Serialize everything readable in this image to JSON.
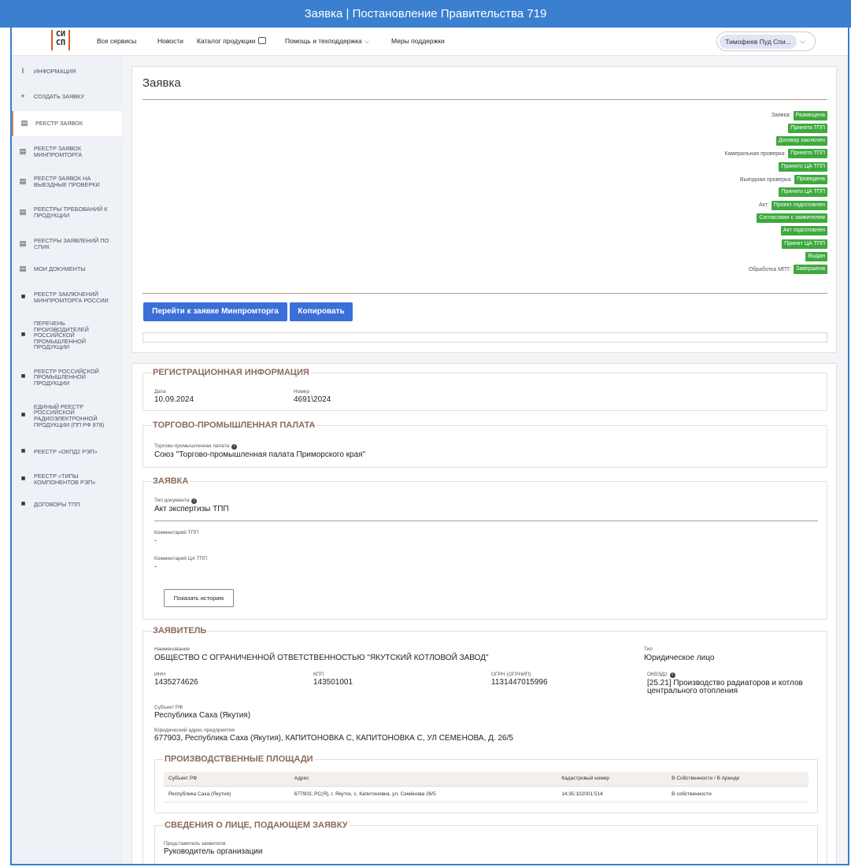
{
  "window_title": "Заявка | Постановление Правительства 719",
  "nav": {
    "logo": "СИ СП",
    "links": [
      "Все сервисы",
      "Новости",
      "Каталог продукции",
      "Помощь и техподдержка",
      "Меры поддержки"
    ],
    "user": "Тимофеев Пуд Спи..."
  },
  "sidebar": {
    "items": [
      {
        "label": "Информация",
        "icon": "info-icon"
      },
      {
        "label": "Создать заявку",
        "icon": "plus-icon"
      },
      {
        "label": "Реестр заявок",
        "icon": "document-icon"
      },
      {
        "label": "Реестр заявок Минпромторга",
        "icon": "document-icon"
      },
      {
        "label": "Реестр заявок на выездные проверки",
        "icon": "document-icon"
      },
      {
        "label": "Реестры требований к продукции",
        "icon": "document-icon"
      },
      {
        "label": "Реестры заявлений по СПИК",
        "icon": "document-icon"
      },
      {
        "label": "Мои документы",
        "icon": "document-icon"
      },
      {
        "label": "Реестр заключений Минпромторга России",
        "icon": "book-icon"
      },
      {
        "label": "Перечень производителей российской промышленной продукции",
        "icon": "book-icon"
      },
      {
        "label": "Реестр российской промышленной продукции",
        "icon": "book-icon"
      },
      {
        "label": "Единый реестр российской радиоэлектронной продукции (ПП РФ 878)",
        "icon": "book-icon"
      },
      {
        "label": "Реестр «ОКПД2 РЭП»",
        "icon": "book-icon"
      },
      {
        "label": "Реестр «Типы компонентов РЭП»",
        "icon": "book-icon"
      },
      {
        "label": "Договоры ТПП",
        "icon": "book-icon"
      }
    ],
    "active_index": 2
  },
  "request": {
    "title": "Заявка",
    "statuses": [
      {
        "label": "Заявка:",
        "value": "Размещена"
      },
      {
        "label": "",
        "value": "Принята ТПП"
      },
      {
        "label": "",
        "value": "Договор заключен"
      },
      {
        "label": "Камеральная проверка:",
        "value": "Принято ТПП"
      },
      {
        "label": "",
        "value": "Принято ЦА ТПП"
      },
      {
        "label": "Выездная проверка:",
        "value": "Проведена"
      },
      {
        "label": "",
        "value": "Принято ЦА ТПП"
      },
      {
        "label": "Акт:",
        "value": "Проект подготовлен"
      },
      {
        "label": "",
        "value": "Согласован с заявителем"
      },
      {
        "label": "",
        "value": "Акт подготовлен"
      },
      {
        "label": "",
        "value": "Принят ЦА ТПП"
      },
      {
        "label": "",
        "value": "Выдан"
      },
      {
        "label": "Обработка МПТ:",
        "value": "Завершена"
      }
    ],
    "badge_color": "#3ea93e",
    "go_button": "Перейти к заявке Минпромторга",
    "copy_button": "Копировать"
  },
  "registration": {
    "legend": "Регистрационная информация",
    "date_label": "Дата",
    "date": "10.09.2024",
    "number_label": "Номер",
    "number": "4691\\2024"
  },
  "chamber": {
    "legend": "Торгово-промышленная палата",
    "label": "Торгово-промышленная палата",
    "value": "Союз \"Торгово-промышленная палата Приморского края\""
  },
  "application": {
    "legend": "Заявка",
    "doc_type_label": "Тип документа",
    "doc_type": "Акт экспертизы ТПП",
    "comment_tpp_label": "Комментарий ТПП",
    "comment_tpp": "-",
    "comment_ca_label": "Комментарий ЦА ТПП",
    "comment_ca": "-",
    "history_button": "Показать историю"
  },
  "applicant": {
    "legend": "Заявитель",
    "name_label": "Наименование",
    "name": "ОБЩЕСТВО С ОГРАНИЧЕННОЙ ОТВЕТСТВЕННОСТЬЮ \"ЯКУТСКИЙ КОТЛОВОЙ ЗАВОД\"",
    "type_label": "Тип",
    "type": "Юридическое лицо",
    "inn_label": "ИНН",
    "inn": "1435274626",
    "kpp_label": "КПП",
    "kpp": "143501001",
    "ogrn_label": "ОГРН (ОГРНИП)",
    "ogrn": "1131447015996",
    "okved_label": "ОКВЭД2",
    "okved": "[25.21] Производство радиаторов и котлов центрального отопления",
    "subject_label": "Субъект РФ",
    "subject": "Республика Саха (Якутия)",
    "address_label": "Юридический адрес предприятия",
    "address": "677903, Республика Саха (Якутия), КАПИТОНОВКА С, КАПИТОНОВКА С, УЛ СЕМЕНОВА, Д. 26/5"
  },
  "facilities": {
    "legend": "Производственные площади",
    "columns": [
      "Субъект РФ",
      "Адрес",
      "Кадастровый номер",
      "В Собственности / В Аренде"
    ],
    "rows": [
      [
        "Республика Саха (Якутия)",
        "677903, РС(Я), г. Якутск, с. Капитоновка, ул. Семёнова 26/5",
        "14:35:102001:514",
        "В собственности"
      ]
    ]
  },
  "submitter": {
    "legend": "Сведения о лице, подающем заявку",
    "rep_label": "Представитель заявителя",
    "rep": "Руководитель организации"
  }
}
